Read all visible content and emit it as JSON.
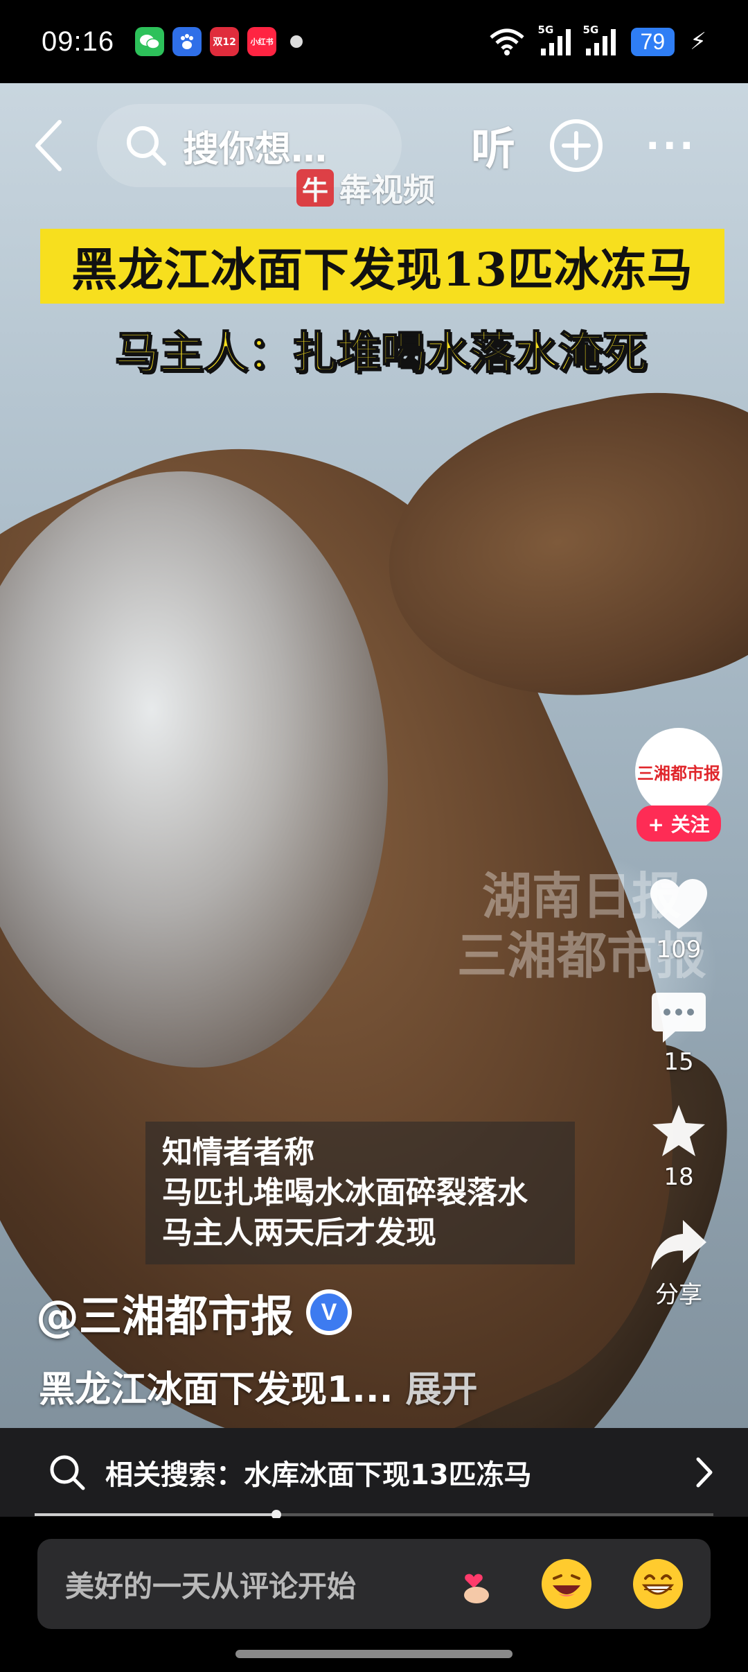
{
  "status_bar": {
    "time": "09:16",
    "apps": [
      {
        "icon": "wechat-icon",
        "color": "#2dc15a",
        "label": ""
      },
      {
        "icon": "baidu-icon",
        "color": "#2f6fe8",
        "label": ""
      },
      {
        "icon": "gift-app-icon",
        "color": "#e02c3c",
        "label": "双12"
      },
      {
        "icon": "xiaohongshu-icon",
        "color": "#ff2442",
        "label": "小红书"
      }
    ],
    "signal1": "5G",
    "signal2": "5G",
    "battery": "79"
  },
  "top_nav": {
    "search_placeholder": "搜你想…",
    "listen_label": "听",
    "watermark": "犇视频"
  },
  "video": {
    "headline_line1": "黑龙江冰面下发现13匹冰冻马",
    "headline_line2": "马主人：扎堆喝水落水淹死",
    "caption_lines": [
      "知情者者称",
      "马匹扎堆喝水冰面碎裂落水",
      "马主人两天后才发现"
    ],
    "overlay_watermark_lines": [
      "湖南日报",
      "三湘都市报"
    ]
  },
  "actions": {
    "avatar_text": "三湘都市报",
    "follow_label": "+ 关注",
    "like_count": "109",
    "comment_count": "15",
    "favorite_count": "18",
    "share_label": "分享"
  },
  "info": {
    "author": "@三湘都市报",
    "verified_mark": "V",
    "description": "黑龙江冰面下发现1...",
    "expand_label": "展开"
  },
  "related": {
    "label": "相关搜索：水库冰面下现13匹冻马"
  },
  "progress": {
    "fraction": 0.356
  },
  "comment_bar": {
    "placeholder": "美好的一天从评论开始",
    "emojis": [
      "finger-heart-emoji",
      "laughing-emoji",
      "grinning-emoji"
    ]
  }
}
